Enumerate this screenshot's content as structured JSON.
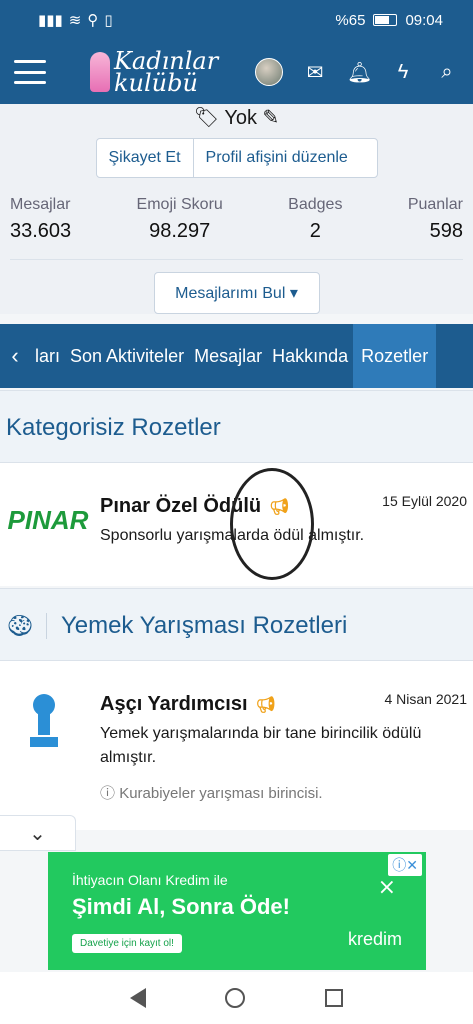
{
  "status_bar": {
    "battery": "%65",
    "time": "09:04"
  },
  "app": {
    "logo_line1": "Kadınlar",
    "logo_line2": "kulübü"
  },
  "profile": {
    "title_text": "Yok",
    "report_button": "Şikayet Et",
    "edit_button": "Profil afişini düzenle",
    "stats": [
      {
        "label": "Mesajlar",
        "value": "33.603"
      },
      {
        "label": "Emoji Skoru",
        "value": "98.297"
      },
      {
        "label": "Badges",
        "value": "2"
      },
      {
        "label": "Puanlar",
        "value": "598"
      }
    ],
    "find_messages_button": "Mesajlarımı Bul ▾"
  },
  "tabs": [
    {
      "label": "ları"
    },
    {
      "label": "Son Aktiviteler"
    },
    {
      "label": "Mesajlar"
    },
    {
      "label": "Hakkında"
    },
    {
      "label": "Rozetler"
    }
  ],
  "sections": [
    {
      "title": "Kategorisiz Rozetler",
      "badge": {
        "title": "Pınar Özel Ödülü",
        "date": "15 Eylül 2020",
        "description": "Sponsorlu yarışmalarda ödül almıştır.",
        "logo_text": "PINAR"
      }
    },
    {
      "title": "Yemek Yarışması Rozetleri",
      "badge": {
        "title": "Aşçı Yardımcısı",
        "date": "4 Nisan 2021",
        "description": "Yemek yarışmalarında bir tane birincilik ödülü almıştır.",
        "hint": "Kurabiyeler yarışması birincisi."
      }
    }
  ],
  "ad": {
    "subtitle": "İhtiyacın Olanı Kredim ile",
    "headline": "Şimdi Al, Sonra Öde!",
    "cta": "Davetiye için kayıt ol!",
    "brand": "kredim"
  }
}
